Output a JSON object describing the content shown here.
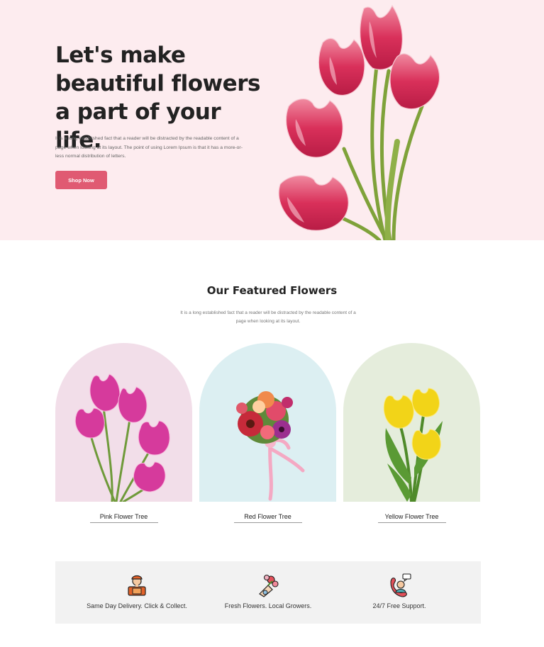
{
  "hero": {
    "heading": "Let's make beautiful flowers a part of your life.",
    "description": "It is a long established fact that a reader will be distracted by the readable content of a page when looking at its layout. The point of using Lorem Ipsum is that it has a more-or-less normal distribution of letters.",
    "cta_label": "Shop Now",
    "background": "#fdecef",
    "accent": "#e05a72"
  },
  "featured": {
    "title": "Our Featured Flowers",
    "description": "It is a long established fact that a reader will be distracted by the readable content of a page when looking at its layout.",
    "cards": [
      {
        "label": "Pink Flower Tree",
        "background": "#f2dee9",
        "image": "pink-tulips"
      },
      {
        "label": "Red Flower Tree",
        "background": "#dceff2",
        "image": "red-bouquet"
      },
      {
        "label": "Yellow Flower Tree",
        "background": "#e5eddc",
        "image": "yellow-tulips"
      }
    ]
  },
  "features": {
    "items": [
      {
        "label": "Same Day Delivery. Click & Collect.",
        "icon": "delivery-person-icon"
      },
      {
        "label": "Fresh Flowers. Local Growers.",
        "icon": "flower-bouquet-icon"
      },
      {
        "label": "24/7 Free Support.",
        "icon": "support-agent-icon"
      }
    ]
  }
}
